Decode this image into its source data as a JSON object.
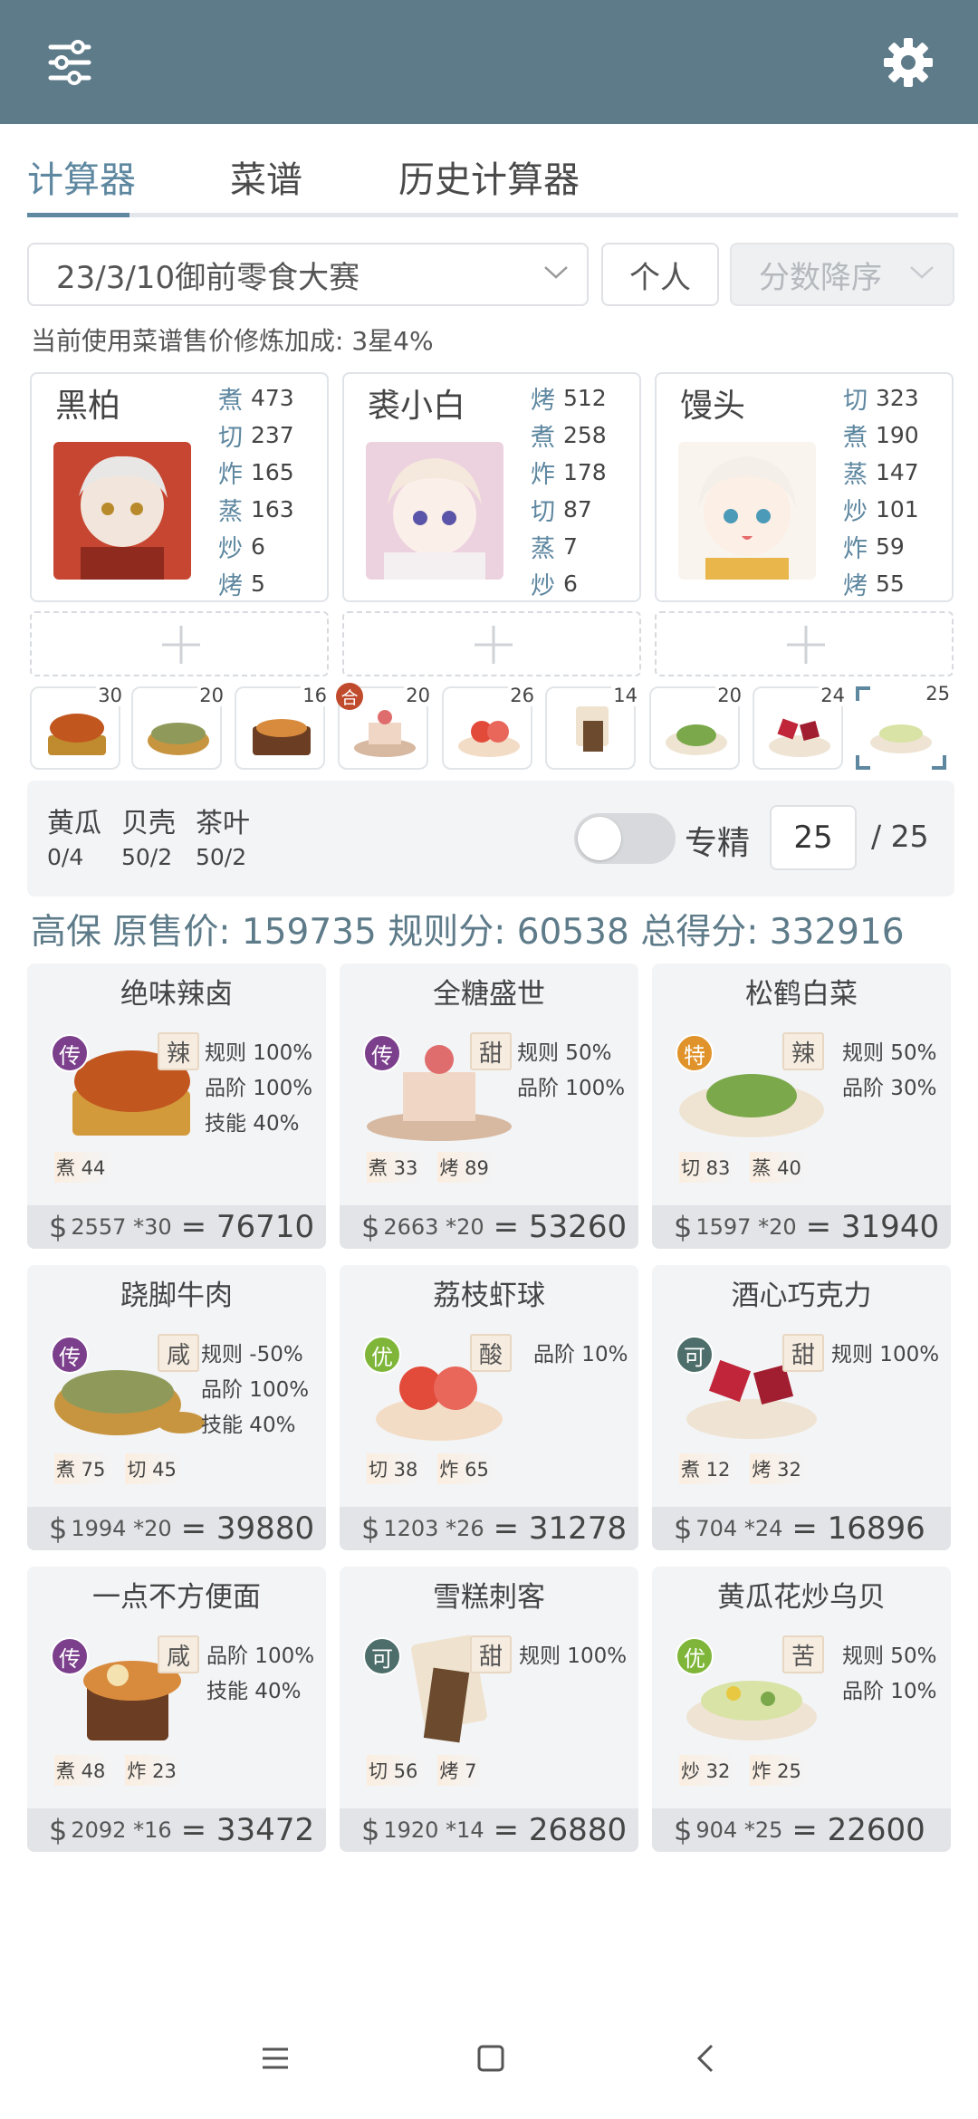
{
  "topbar": {
    "left_icon": "sliders-icon",
    "right_icon": "gear-icon",
    "bg": "#5e7b89"
  },
  "tabs": [
    {
      "label": "计算器",
      "active": true
    },
    {
      "label": "菜谱",
      "active": false
    },
    {
      "label": "历史计算器",
      "active": false
    }
  ],
  "selectors": {
    "event": "23/3/10御前零食大赛",
    "person": "个人",
    "sort_placeholder": "分数降序"
  },
  "bonus_text": "当前使用菜谱售价修炼加成: 3星4%",
  "chefs": [
    {
      "name": "黑柏",
      "stats": [
        [
          "煮",
          "473"
        ],
        [
          "切",
          "237"
        ],
        [
          "炸",
          "165"
        ],
        [
          "蒸",
          "163"
        ],
        [
          "炒",
          "6"
        ],
        [
          "烤",
          "5"
        ]
      ]
    },
    {
      "name": "裘小白",
      "stats": [
        [
          "烤",
          "512"
        ],
        [
          "煮",
          "258"
        ],
        [
          "炸",
          "178"
        ],
        [
          "切",
          "87"
        ],
        [
          "蒸",
          "7"
        ],
        [
          "炒",
          "6"
        ]
      ]
    },
    {
      "name": "馒头",
      "stats": [
        [
          "切",
          "323"
        ],
        [
          "煮",
          "190"
        ],
        [
          "蒸",
          "147"
        ],
        [
          "炒",
          "101"
        ],
        [
          "炸",
          "59"
        ],
        [
          "烤",
          "55"
        ]
      ]
    }
  ],
  "dish_icons": [
    "30",
    "20",
    "16",
    "20",
    "26",
    "14",
    "20",
    "24",
    "25"
  ],
  "dish_icon_badge": "合",
  "ingredients": [
    {
      "name": "黄瓜",
      "value": "0/4"
    },
    {
      "name": "贝壳",
      "value": "50/2"
    },
    {
      "name": "茶叶",
      "value": "50/2"
    }
  ],
  "specialize_label": "专精",
  "quantity": "25",
  "quantity_max": "/ 25",
  "summary": "高保 原售价: 159735 规则分: 60538 总得分: 332916",
  "recipes": [
    {
      "name": "绝味辣卤",
      "rarity": "传",
      "rarity_color": "#7b3f8c",
      "flavor": "辣",
      "mods": [
        "规则 100%",
        "品阶 100%",
        "技能 40%"
      ],
      "skills": [
        "煮 44"
      ],
      "price": "2557",
      "mult": "*30",
      "total": "= 76710"
    },
    {
      "name": "全糖盛世",
      "rarity": "传",
      "rarity_color": "#7b3f8c",
      "flavor": "甜",
      "mods": [
        "规则 50%",
        "品阶 100%"
      ],
      "skills": [
        "煮 33",
        "烤 89"
      ],
      "price": "2663",
      "mult": "*20",
      "total": "= 53260"
    },
    {
      "name": "松鹤白菜",
      "rarity": "特",
      "rarity_color": "#e0932a",
      "flavor": "辣",
      "mods": [
        "规则 50%",
        "品阶 30%"
      ],
      "skills": [
        "切 83",
        "蒸 40"
      ],
      "price": "1597",
      "mult": "*20",
      "total": "= 31940"
    },
    {
      "name": "跷脚牛肉",
      "rarity": "传",
      "rarity_color": "#7b3f8c",
      "flavor": "咸",
      "mods": [
        "规则 -50%",
        "品阶 100%",
        "技能 40%"
      ],
      "skills": [
        "煮 75",
        "切 45"
      ],
      "price": "1994",
      "mult": "*20",
      "total": "= 39880"
    },
    {
      "name": "荔枝虾球",
      "rarity": "优",
      "rarity_color": "#7fb63a",
      "flavor": "酸",
      "mods": [
        "品阶 10%"
      ],
      "skills": [
        "切 38",
        "炸 65"
      ],
      "price": "1203",
      "mult": "*26",
      "total": "= 31278"
    },
    {
      "name": "酒心巧克力",
      "rarity": "可",
      "rarity_color": "#4d6e6a",
      "flavor": "甜",
      "mods": [
        "规则 100%"
      ],
      "skills": [
        "煮 12",
        "烤 32"
      ],
      "price": "704",
      "mult": "*24",
      "total": "= 16896"
    },
    {
      "name": "一点不方便面",
      "rarity": "传",
      "rarity_color": "#7b3f8c",
      "flavor": "咸",
      "mods": [
        "品阶 100%",
        "技能 40%"
      ],
      "skills": [
        "煮 48",
        "炸 23"
      ],
      "price": "2092",
      "mult": "*16",
      "total": "= 33472"
    },
    {
      "name": "雪糕刺客",
      "rarity": "可",
      "rarity_color": "#4d6e6a",
      "flavor": "甜",
      "mods": [
        "规则 100%"
      ],
      "skills": [
        "切 56",
        "烤 7"
      ],
      "price": "1920",
      "mult": "*14",
      "total": "= 26880"
    },
    {
      "name": "黄瓜花炒乌贝",
      "rarity": "优",
      "rarity_color": "#7fb63a",
      "flavor": "苦",
      "mods": [
        "规则 50%",
        "品阶 10%"
      ],
      "skills": [
        "炒 32",
        "炸 25"
      ],
      "price": "904",
      "mult": "*25",
      "total": "= 22600"
    }
  ],
  "navbar": [
    "menu-icon",
    "home-icon",
    "back-icon"
  ]
}
